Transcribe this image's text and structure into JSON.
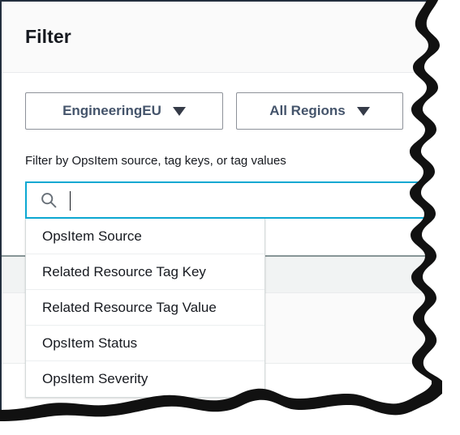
{
  "panel": {
    "title": "Filter"
  },
  "filters": {
    "account_button": {
      "label": "EngineeringEU",
      "caret": "chevron-down-icon"
    },
    "region_button": {
      "label": "All Regions",
      "caret": "chevron-down-icon"
    }
  },
  "search": {
    "label": "Filter by OpsItem source, tag keys, or tag values",
    "value": "",
    "placeholder": "",
    "icon": "search-icon",
    "focused": true,
    "border_color": "#0ca8d2"
  },
  "dropdown": {
    "open": true,
    "items": [
      {
        "label": "OpsItem Source"
      },
      {
        "label": "Related Resource Tag Key"
      },
      {
        "label": "Related Resource Tag Value"
      },
      {
        "label": "OpsItem Status"
      },
      {
        "label": "OpsItem Severity"
      }
    ]
  },
  "colors": {
    "accent": "#0ca8d2",
    "panel_header_bg": "#fafafa",
    "table_header_bg": "#f1f3f3",
    "text": "#16191f",
    "button_text": "#44546b",
    "border": "#8d9199"
  }
}
